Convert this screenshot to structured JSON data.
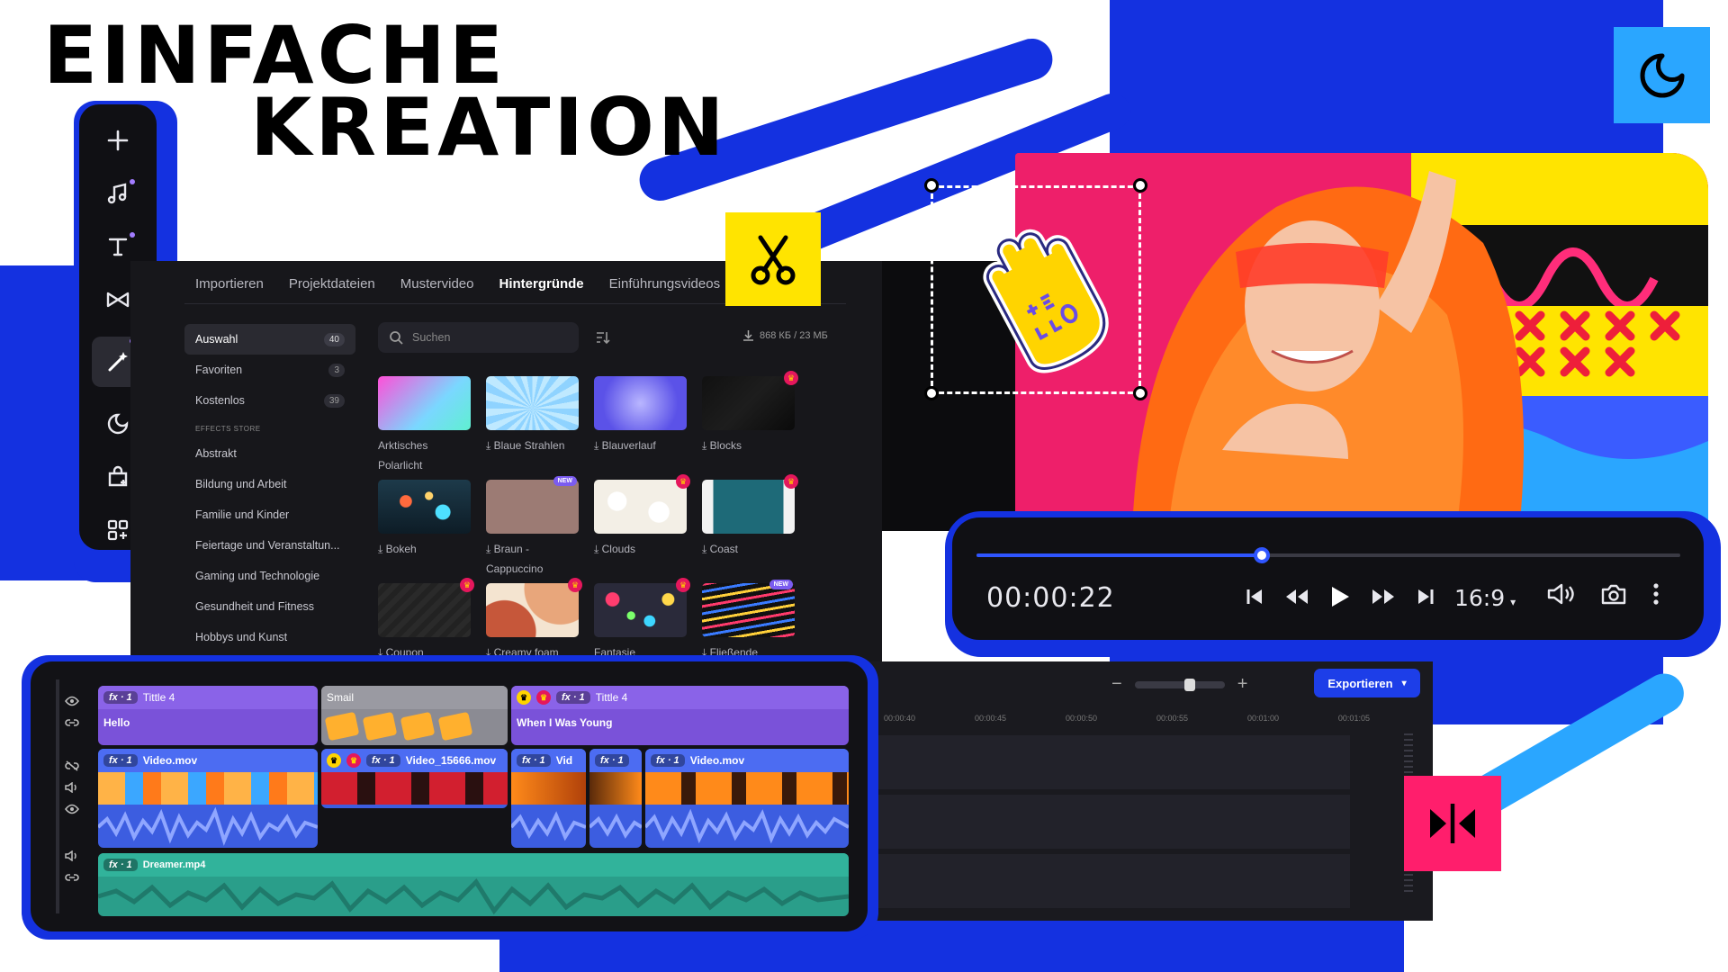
{
  "headline": {
    "line1": "EINFACHE",
    "line2": "KREATION"
  },
  "rail": {
    "items": [
      {
        "icon": "plus-icon",
        "badge": false,
        "active": false
      },
      {
        "icon": "music-note-icon",
        "badge": true,
        "active": false
      },
      {
        "icon": "text-icon",
        "badge": true,
        "active": false
      },
      {
        "icon": "transition-icon",
        "badge": false,
        "active": false
      },
      {
        "icon": "magic-wand-icon",
        "badge": true,
        "active": true
      },
      {
        "icon": "sticker-icon",
        "badge": false,
        "active": false
      },
      {
        "icon": "store-bag-icon",
        "badge": false,
        "active": false
      },
      {
        "icon": "more-apps-icon",
        "badge": false,
        "active": false
      }
    ]
  },
  "tabs": [
    "Importieren",
    "Projektdateien",
    "Mustervideo",
    "Hintergründe",
    "Einführungsvideos"
  ],
  "selected_tab": "Hintergründe",
  "categories": [
    {
      "label": "Auswahl",
      "count": "40",
      "selected": true
    },
    {
      "label": "Favoriten",
      "count": "3",
      "selected": false
    },
    {
      "label": "Kostenlos",
      "count": "39",
      "selected": false
    }
  ],
  "store_label": "EFFECTS STORE",
  "store_categories": [
    "Abstrakt",
    "Bildung und Arbeit",
    "Familie und Kinder",
    "Feiertage und Veranstaltun...",
    "Gaming und Technologie",
    "Gesundheit und Fitness",
    "Hobbys und Kunst"
  ],
  "search": {
    "placeholder": "Suchen"
  },
  "storage": "868 КБ / 23 МБ",
  "tiles": [
    {
      "label": "Arktisches Polarlicht",
      "download": false,
      "badge": "",
      "bg": "linear-gradient(135deg,#ff4fd8,#7ad7ff 60%,#5ff0d0)"
    },
    {
      "label": "Blaue Strahlen",
      "download": true,
      "badge": "",
      "bg": "repeating-conic-gradient(from 0deg at 50% 60%,#bfe9ff 0 10deg,#8fd3ff 10deg 20deg)"
    },
    {
      "label": "Blauverlauf",
      "download": true,
      "badge": "",
      "bg": "radial-gradient(circle at 50% 50%,#b9b6ff,#5b52e8 70%)"
    },
    {
      "label": "Blocks",
      "download": true,
      "badge": "crown",
      "bg": "linear-gradient(135deg,#111 0%,#1d1d1d 50%,#0a0a0a 100%)"
    },
    {
      "label": "Bokeh",
      "download": true,
      "badge": "",
      "bg": "radial-gradient(circle at 30% 40%,#ff6a3d 0 8%,transparent 9%),radial-gradient(circle at 70% 60%,#4ee0ff 0 10%,transparent 11%),radial-gradient(circle at 55% 30%,#ffd36b 0 6%,transparent 7%),linear-gradient(#1d3a4a,#0d1c26)"
    },
    {
      "label": "Braun - Cappuccino",
      "download": true,
      "badge": "new",
      "bg": "#9c7b74"
    },
    {
      "label": "Clouds",
      "download": true,
      "badge": "crown",
      "bg": "radial-gradient(circle at 25% 40%,#fff 0 12%,transparent 13%),radial-gradient(circle at 70% 60%,#fff 0 14%,transparent 15%),#f3efe6"
    },
    {
      "label": "Coast",
      "download": true,
      "badge": "crown",
      "bg": "linear-gradient(90deg,#f2f2f2 0 12%,#1e6a78 12% 88%,#f2f2f2 88%)"
    },
    {
      "label": "Coupon",
      "download": true,
      "badge": "crown",
      "bg": "repeating-linear-gradient(135deg,#2a2a2a 0 6px,#222 6px 12px)"
    },
    {
      "label": "Creamy foam",
      "download": true,
      "badge": "crown",
      "bg": "radial-gradient(circle at 20% 90%,#c6573a 0 35%,transparent 36%),radial-gradient(circle at 80% 10%,#e8a67b 0 40%,transparent 41%),#f4e4d0"
    },
    {
      "label": "Fantasie",
      "download": false,
      "badge": "crown",
      "bg": "radial-gradient(circle at 20% 30%,#ff3d6e 0 8%,transparent 9%),radial-gradient(circle at 60% 70%,#3dd6ff 0 8%,transparent 9%),radial-gradient(circle at 80% 30%,#ffd84a 0 7%,transparent 8%),radial-gradient(circle at 40% 60%,#7bff6b 0 6%,transparent 7%),#2a2a3a"
    },
    {
      "label": "Fließende",
      "download": true,
      "badge": "new",
      "bg": "repeating-linear-gradient(170deg,#ff3a6c 0 3px,#111 3px 8px,#3a7bff 8px 11px,#111 11px 16px,#ffd03a 16px 19px,#111 19px 24px)"
    }
  ],
  "player": {
    "time": "00:00:22",
    "ratio": "16:9",
    "progress": 0.405
  },
  "timeline_right": {
    "export_label": "Exportieren",
    "ruler": [
      "00:00:40",
      "00:00:45",
      "00:00:50",
      "00:00:55",
      "00:01:00",
      "00:01:05"
    ],
    "zoom_minus": "−",
    "zoom_plus": "+"
  },
  "clips": {
    "title1": {
      "fx": "fx · 1",
      "name": "Tittle 4",
      "text": "Hello"
    },
    "smail": {
      "name": "Smail"
    },
    "title2": {
      "fx": "fx · 1",
      "name": "Tittle 4",
      "text": "When I Was Young"
    },
    "video1": {
      "fx": "fx · 1",
      "name": "Video.mov"
    },
    "video2": {
      "fx": "fx · 1",
      "name": "Video_15666.mov"
    },
    "video3": {
      "fx": "fx · 1",
      "name": "Vid"
    },
    "video4": {
      "fx": "fx · 1",
      "name": ""
    },
    "video5": {
      "fx": "fx · 1",
      "name": "Video.mov"
    },
    "audio": {
      "fx": "fx · 1",
      "name": "Dreamer.mp4"
    }
  },
  "colors": {
    "brand_blue": "#1431e0",
    "accent_yellow": "#ffe400",
    "accent_pink": "#ff1e6c",
    "accent_cyan": "#2aa6ff"
  }
}
